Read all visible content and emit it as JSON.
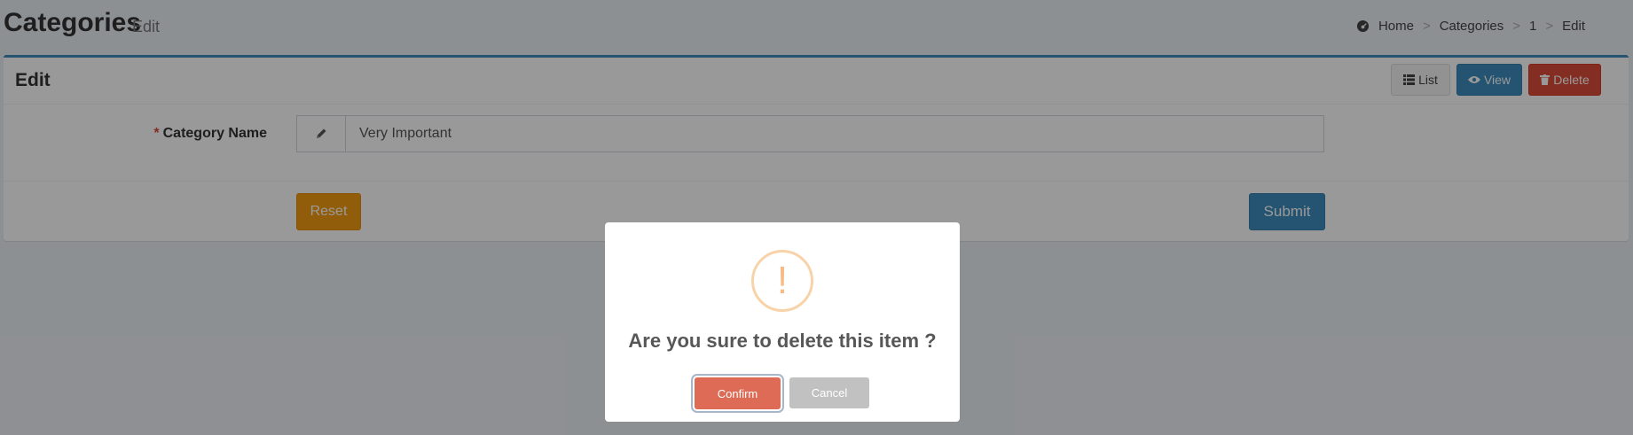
{
  "header": {
    "title": "Categories",
    "subtitle": "Edit",
    "breadcrumb": [
      "Home",
      "Categories",
      "1",
      "Edit"
    ]
  },
  "box": {
    "title": "Edit",
    "tools": {
      "list_label": "List",
      "view_label": "View",
      "delete_label": "Delete"
    }
  },
  "form": {
    "required_mark": "*",
    "category_name_label": "Category Name",
    "category_name_value": "Very Important",
    "reset_label": "Reset",
    "submit_label": "Submit"
  },
  "dialog": {
    "icon": "!",
    "message": "Are you sure to delete this item ?",
    "confirm_label": "Confirm",
    "cancel_label": "Cancel"
  },
  "colors": {
    "accent": "#3c8dbc",
    "danger": "#dd4b39",
    "warning": "#f39c12",
    "confirm": "#dd6b55",
    "cancel": "#c1c1c1"
  }
}
